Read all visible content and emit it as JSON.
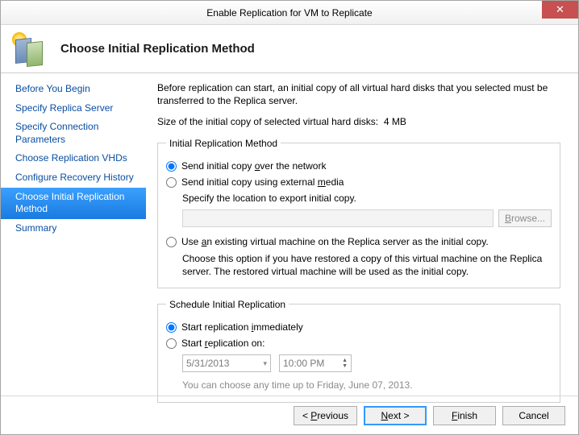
{
  "window": {
    "title": "Enable Replication for VM to Replicate",
    "close_glyph": "✕"
  },
  "header": {
    "title": "Choose Initial Replication Method"
  },
  "sidebar": {
    "items": [
      {
        "label": "Before You Begin"
      },
      {
        "label": "Specify Replica Server"
      },
      {
        "label": "Specify Connection Parameters"
      },
      {
        "label": "Choose Replication VHDs"
      },
      {
        "label": "Configure Recovery History"
      },
      {
        "label": "Choose Initial Replication Method",
        "selected": true
      },
      {
        "label": "Summary"
      }
    ]
  },
  "content": {
    "intro": "Before replication can start, an initial copy of all virtual hard disks that you selected must be transferred to the Replica server.",
    "size_label": "Size of the initial copy of selected virtual hard disks:",
    "size_value": "4 MB",
    "method_group": {
      "legend": "Initial Replication Method",
      "opt_network": "Send initial copy over the network",
      "opt_external": "Send initial copy using external media",
      "external_sub": "Specify the location to export initial copy.",
      "browse_label": "Browse...",
      "opt_existing": "Use an existing virtual machine on the Replica server as the initial copy.",
      "existing_desc": "Choose this option if you have restored a copy of this virtual machine on the Replica server. The restored virtual machine will be used as the initial copy.",
      "selected": "network"
    },
    "schedule_group": {
      "legend": "Schedule Initial Replication",
      "opt_immediate": "Start replication immediately",
      "opt_on": "Start replication on:",
      "date_value": "5/31/2013",
      "time_value": "10:00 PM",
      "hint": "You can choose any time up to Friday, June 07, 2013.",
      "selected": "immediate"
    }
  },
  "footer": {
    "previous": "< Previous",
    "next": "Next >",
    "finish": "Finish",
    "cancel": "Cancel"
  }
}
